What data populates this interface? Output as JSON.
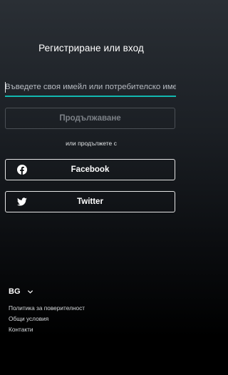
{
  "page": {
    "title": "Регистриране или вход"
  },
  "login": {
    "email_placeholder": "Въведете своя имейл или потребителско име",
    "email_value": "",
    "continue_label": "Продължаване",
    "or_text": "или продължете с"
  },
  "social": {
    "facebook_label": "Facebook",
    "twitter_label": "Twitter",
    "icons": [
      "facebook-icon",
      "twitter-icon"
    ]
  },
  "footer": {
    "language": "BG",
    "links": [
      "Политика за поверителност",
      "Общи условия",
      "Контакти"
    ]
  },
  "colors": {
    "accent": "#12b8b0",
    "background_top": "#2a2f35",
    "background_bottom": "#000000",
    "disabled_text": "#7c8187"
  }
}
